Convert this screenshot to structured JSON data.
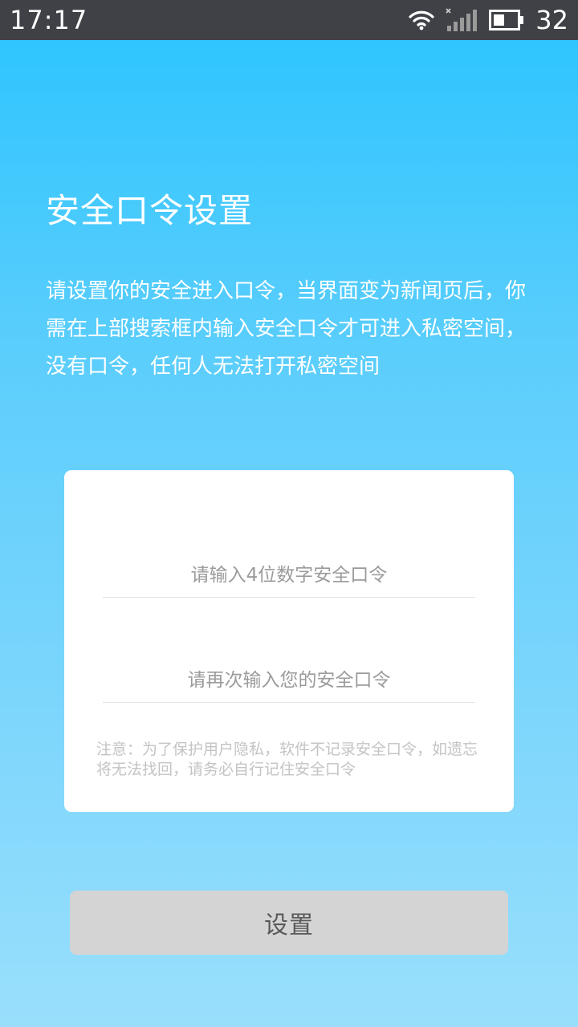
{
  "status_bar": {
    "time": "17:17",
    "battery_level": "32",
    "icons": [
      "wifi-icon",
      "signal-icon",
      "battery-icon"
    ]
  },
  "page": {
    "title": "安全口令设置",
    "description": "请设置你的安全进入口令，当界面变为新闻页后，你需在上部搜索框内输入安全口令才可进入私密空间，没有口令，任何人无法打开私密空间"
  },
  "form": {
    "passcode_placeholder": "请输入4位数字安全口令",
    "passcode_value": "",
    "confirm_placeholder": "请再次输入您的安全口令",
    "confirm_value": "",
    "notice": "注意：为了保护用户隐私，软件不记录安全口令，如遗忘将无法找回，请务必自行记住安全口令"
  },
  "actions": {
    "submit_label": "设置"
  },
  "colors": {
    "status_bar": "#3f4147",
    "gradient_top": "#2ac4fe",
    "gradient_bottom": "#99dffc",
    "card": "#ffffff",
    "button_disabled": "#d4d4d4",
    "button_text": "#595959"
  }
}
